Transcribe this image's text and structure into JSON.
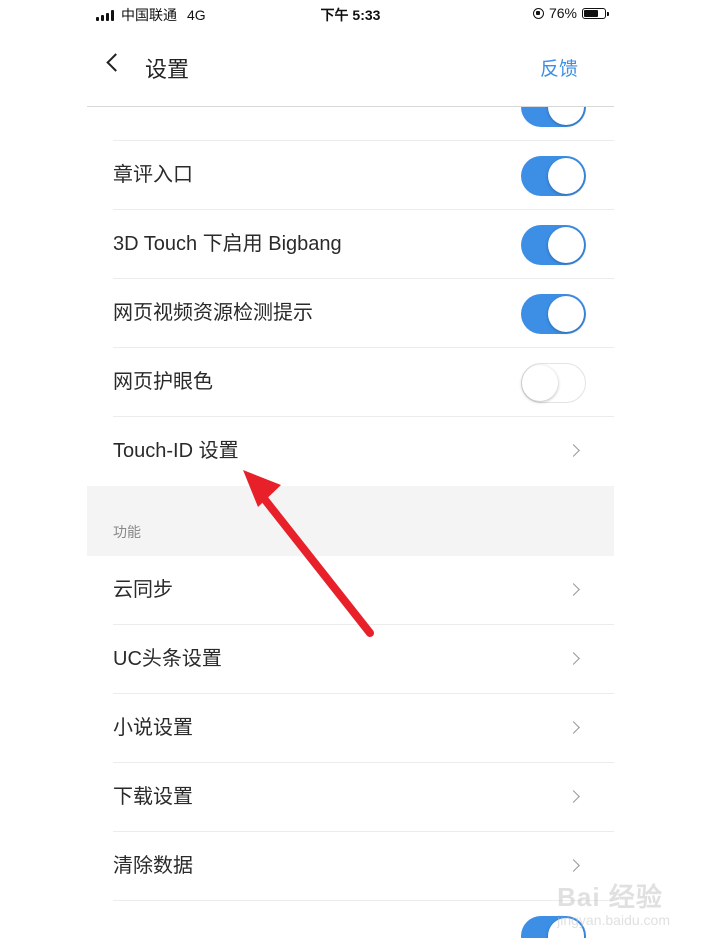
{
  "status_bar": {
    "carrier": "中国联通",
    "network": "4G",
    "time": "下午 5:33",
    "battery_text": "76%",
    "battery_level": 0.76
  },
  "navbar": {
    "title": "设置",
    "feedback": "反馈"
  },
  "settings_rows": [
    {
      "label": "",
      "type": "toggle",
      "on": true
    },
    {
      "label": "章评入口",
      "type": "toggle",
      "on": true
    },
    {
      "label": "3D Touch 下启用 Bigbang",
      "type": "toggle",
      "on": true
    },
    {
      "label": "网页视频资源检测提示",
      "type": "toggle",
      "on": true
    },
    {
      "label": "网页护眼色",
      "type": "toggle",
      "on": false
    },
    {
      "label": "Touch-ID 设置",
      "type": "chevron"
    }
  ],
  "function_section": {
    "header": "功能",
    "rows": [
      {
        "label": "云同步"
      },
      {
        "label": "UC头条设置"
      },
      {
        "label": "小说设置"
      },
      {
        "label": "下载设置"
      },
      {
        "label": "清除数据"
      }
    ]
  },
  "colors": {
    "accent": "#3d8fe6",
    "annotation_arrow": "#e8202a",
    "section_bg": "#f4f4f4"
  },
  "watermark": {
    "main": "Bai 经验",
    "sub": "jingyan.baidu.com"
  }
}
